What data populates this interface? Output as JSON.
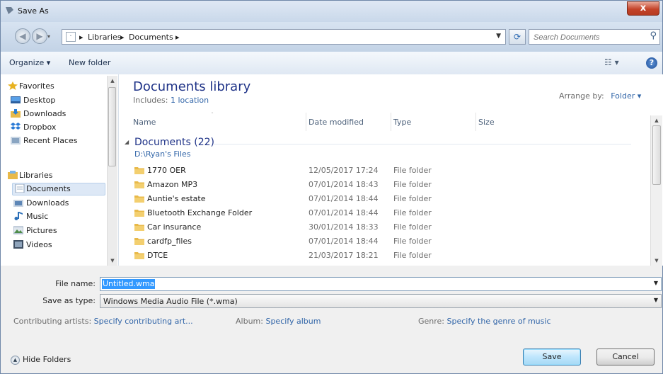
{
  "window": {
    "title": "Save As",
    "close_glyph": "x"
  },
  "address": {
    "crumbs": [
      "Libraries",
      "Documents"
    ],
    "separator": "▸",
    "search_placeholder": "Search Documents"
  },
  "toolbar": {
    "organize": "Organize ▾",
    "new_folder": "New folder",
    "view": "☷ ▾",
    "help": "?"
  },
  "sidebar": {
    "favorites": [
      {
        "label": "Favorites",
        "icon": "star-icon"
      },
      {
        "label": "Desktop",
        "icon": "desktop-icon"
      },
      {
        "label": "Downloads",
        "icon": "downloads-icon"
      },
      {
        "label": "Dropbox",
        "icon": "dropbox-icon"
      },
      {
        "label": "Recent Places",
        "icon": "recent-places-icon"
      }
    ],
    "libraries": [
      {
        "label": "Libraries",
        "icon": "libraries-icon"
      },
      {
        "label": "Documents",
        "icon": "documents-icon",
        "selected": true
      },
      {
        "label": "Downloads",
        "icon": "downloads-icon"
      },
      {
        "label": "Music",
        "icon": "music-icon"
      },
      {
        "label": "Pictures",
        "icon": "pictures-icon"
      },
      {
        "label": "Videos",
        "icon": "videos-icon"
      }
    ]
  },
  "library": {
    "title": "Documents library",
    "includes_label": "Includes:",
    "includes_value": "1 location",
    "arrange_label": "Arrange by:",
    "arrange_value": "Folder ▾"
  },
  "columns": {
    "name": "Name",
    "date": "Date modified",
    "type": "Type",
    "size": "Size"
  },
  "group": {
    "header": "Documents (22)",
    "path": "D:\\Ryan's Files"
  },
  "files": [
    {
      "name": "1770 OER",
      "date": "12/05/2017 17:24",
      "type": "File folder"
    },
    {
      "name": "Amazon MP3",
      "date": "07/01/2014 18:43",
      "type": "File folder"
    },
    {
      "name": "Auntie's estate",
      "date": "07/01/2014 18:44",
      "type": "File folder"
    },
    {
      "name": "Bluetooth Exchange Folder",
      "date": "07/01/2014 18:44",
      "type": "File folder"
    },
    {
      "name": "Car insurance",
      "date": "30/01/2014 18:33",
      "type": "File folder"
    },
    {
      "name": "cardfp_files",
      "date": "07/01/2014 18:44",
      "type": "File folder"
    },
    {
      "name": "DTCE",
      "date": "21/03/2017 18:21",
      "type": "File folder"
    }
  ],
  "form": {
    "filename_label": "File name:",
    "filename_value": "Untitled.wma",
    "savetype_label": "Save as type:",
    "savetype_value": "Windows Media Audio File (*.wma)",
    "artists_label": "Contributing artists:",
    "artists_value": "Specify contributing art...",
    "album_label": "Album:",
    "album_value": "Specify album",
    "genre_label": "Genre:",
    "genre_value": "Specify the genre of music"
  },
  "footer": {
    "hide_folders": "Hide Folders",
    "save": "Save",
    "cancel": "Cancel"
  },
  "colors": {
    "accent_blue": "#1e3287",
    "link_blue": "#3165a8",
    "selection": "#3399ff",
    "folder_yellow": "#e8b949",
    "close_red": "#c4442a"
  }
}
